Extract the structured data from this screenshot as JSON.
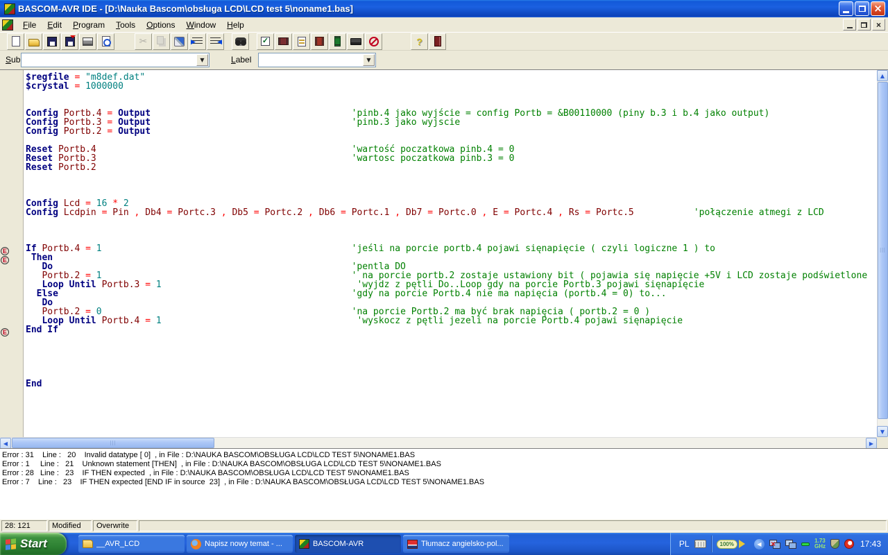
{
  "window": {
    "title": "BASCOM-AVR IDE - [D:\\Nauka Bascom\\obsługa LCD\\LCD test 5\\noname1.bas]"
  },
  "menu": {
    "items": [
      "File",
      "Edit",
      "Program",
      "Tools",
      "Options",
      "Window",
      "Help"
    ]
  },
  "toolbar": {
    "buttons": [
      {
        "name": "new-file-button",
        "icon": "new-file-icon",
        "cls": "i-new"
      },
      {
        "name": "open-file-button",
        "icon": "open-folder-icon",
        "cls": "i-open"
      },
      {
        "name": "save-button",
        "icon": "save-floppy-icon",
        "cls": "i-save"
      },
      {
        "name": "save-all-button",
        "icon": "save-all-icon",
        "cls": "i-saveas"
      },
      {
        "name": "print-button",
        "icon": "printer-icon",
        "cls": "i-print"
      },
      {
        "name": "print-preview-button",
        "icon": "print-preview-icon",
        "cls": "i-preview"
      },
      {
        "name": "cut-button",
        "icon": "scissors-icon",
        "cls": "i-cut",
        "glyph": "✂",
        "disabled": true,
        "gap": true
      },
      {
        "name": "copy-button",
        "icon": "copy-icon",
        "cls": "i-copy",
        "disabled": true
      },
      {
        "name": "format-brush-button",
        "icon": "brush-icon",
        "cls": "i-brush"
      },
      {
        "name": "indent-button",
        "icon": "indent-icon",
        "cls": "i-ind"
      },
      {
        "name": "unindent-button",
        "icon": "unindent-icon",
        "cls": "i-unind"
      },
      {
        "name": "find-button",
        "icon": "binoculars-icon",
        "cls": "i-find",
        "gap2": true
      },
      {
        "name": "syntax-check-button",
        "icon": "check-icon",
        "cls": "i-check",
        "glyph": "✓",
        "gap2": true
      },
      {
        "name": "compile-button",
        "icon": "compile-chip-icon",
        "cls": "i-chip1"
      },
      {
        "name": "show-result-button",
        "icon": "show-result-icon",
        "cls": "i-result"
      },
      {
        "name": "program-chip-button",
        "icon": "program-chip-icon",
        "cls": "i-chip2"
      },
      {
        "name": "simulator-button",
        "icon": "simulator-icon",
        "cls": "i-sim"
      },
      {
        "name": "terminal-button",
        "icon": "terminal-icon",
        "cls": "i-term"
      },
      {
        "name": "stop-button",
        "icon": "stop-icon",
        "cls": "i-stop"
      },
      {
        "name": "help-button",
        "icon": "help-icon",
        "cls": "i-help",
        "glyph": "?",
        "gap3": true
      },
      {
        "name": "exit-button",
        "icon": "exit-door-icon",
        "cls": "i-exit"
      }
    ]
  },
  "subbar": {
    "sub_label": "Sub",
    "label_label": "Label",
    "sub_value": "",
    "label_value": ""
  },
  "editor": {
    "error_marker_glyph": "E",
    "lines": [
      {
        "tk": [
          {
            "s": "k",
            "t": "$regfile"
          },
          {
            "s": "o",
            "t": " = "
          },
          {
            "s": "v",
            "t": "\"m8def.dat\""
          }
        ]
      },
      {
        "tk": [
          {
            "s": "k",
            "t": "$crystal"
          },
          {
            "s": "o",
            "t": " = "
          },
          {
            "s": "v",
            "t": "1000000"
          }
        ]
      },
      {
        "tk": []
      },
      {
        "tk": []
      },
      {
        "tk": [
          {
            "s": "k",
            "t": "Config"
          },
          {
            "s": "i",
            "t": " Portb.4"
          },
          {
            "s": "o",
            "t": " = "
          },
          {
            "s": "k",
            "t": "Output"
          },
          {
            "p": 37
          },
          {
            "s": "c",
            "t": "'pinb.4 jako wyjście = config Portb = &B00110000 (piny b.3 i b.4 jako output)"
          }
        ]
      },
      {
        "tk": [
          {
            "s": "k",
            "t": "Config"
          },
          {
            "s": "i",
            "t": " Portb.3"
          },
          {
            "s": "o",
            "t": " = "
          },
          {
            "s": "k",
            "t": "Output"
          },
          {
            "p": 37
          },
          {
            "s": "c",
            "t": "'pinb.3 jako wyjscie"
          }
        ]
      },
      {
        "tk": [
          {
            "s": "k",
            "t": "Config"
          },
          {
            "s": "i",
            "t": " Portb.2"
          },
          {
            "s": "o",
            "t": " = "
          },
          {
            "s": "k",
            "t": "Output"
          }
        ]
      },
      {
        "tk": []
      },
      {
        "tk": [
          {
            "s": "k",
            "t": "Reset"
          },
          {
            "s": "i",
            "t": " Portb.4"
          },
          {
            "p": 47
          },
          {
            "s": "c",
            "t": "'wartość poczatkowa pinb.4 = 0"
          }
        ]
      },
      {
        "tk": [
          {
            "s": "k",
            "t": "Reset"
          },
          {
            "s": "i",
            "t": " Portb.3"
          },
          {
            "p": 47
          },
          {
            "s": "c",
            "t": "'wartosc poczatkowa pinb.3 = 0"
          }
        ]
      },
      {
        "tk": [
          {
            "s": "k",
            "t": "Reset"
          },
          {
            "s": "i",
            "t": " Portb.2"
          }
        ]
      },
      {
        "tk": []
      },
      {
        "tk": []
      },
      {
        "tk": []
      },
      {
        "tk": [
          {
            "s": "k",
            "t": "Config"
          },
          {
            "s": "i",
            "t": " Lcd"
          },
          {
            "s": "o",
            "t": " = "
          },
          {
            "s": "v",
            "t": "16"
          },
          {
            "s": "o",
            "t": " * "
          },
          {
            "s": "v",
            "t": "2"
          }
        ]
      },
      {
        "tk": [
          {
            "s": "k",
            "t": "Config"
          },
          {
            "s": "i",
            "t": " Lcdpin"
          },
          {
            "s": "o",
            "t": " = "
          },
          {
            "s": "i",
            "t": "Pin"
          },
          {
            "s": "o",
            "t": " , "
          },
          {
            "s": "i",
            "t": "Db4"
          },
          {
            "s": "o",
            "t": " = "
          },
          {
            "s": "i",
            "t": "Portc.3"
          },
          {
            "s": "o",
            "t": " , "
          },
          {
            "s": "i",
            "t": "Db5"
          },
          {
            "s": "o",
            "t": " = "
          },
          {
            "s": "i",
            "t": "Portc.2"
          },
          {
            "s": "o",
            "t": " , "
          },
          {
            "s": "i",
            "t": "Db6"
          },
          {
            "s": "o",
            "t": " = "
          },
          {
            "s": "i",
            "t": "Portc.1"
          },
          {
            "s": "o",
            "t": " , "
          },
          {
            "s": "i",
            "t": "Db7"
          },
          {
            "s": "o",
            "t": " = "
          },
          {
            "s": "i",
            "t": "Portc.0"
          },
          {
            "s": "o",
            "t": " , "
          },
          {
            "s": "i",
            "t": "E"
          },
          {
            "s": "o",
            "t": " = "
          },
          {
            "s": "i",
            "t": "Portc.4"
          },
          {
            "s": "o",
            "t": " , "
          },
          {
            "s": "i",
            "t": "Rs"
          },
          {
            "s": "o",
            "t": " = "
          },
          {
            "s": "i",
            "t": "Portc.5"
          },
          {
            "p": 11
          },
          {
            "s": "c",
            "t": "'połączenie atmegi z LCD"
          }
        ]
      },
      {
        "tk": []
      },
      {
        "tk": []
      },
      {
        "tk": []
      },
      {
        "e": true,
        "tk": [
          {
            "s": "k",
            "t": "If"
          },
          {
            "s": "i",
            "t": " Portb.4"
          },
          {
            "s": "o",
            "t": " = "
          },
          {
            "s": "v",
            "t": "1"
          },
          {
            "p": 46
          },
          {
            "s": "c",
            "t": "'jeśli na porcie portb.4 pojawi sięnapięcie ( czyli logiczne 1 ) to"
          }
        ]
      },
      {
        "e": true,
        "tk": [
          {
            "s": "k",
            "t": " Then"
          }
        ]
      },
      {
        "tk": [
          {
            "s": "k",
            "t": "   Do"
          },
          {
            "p": 55
          },
          {
            "s": "c",
            "t": "'pentla DO"
          }
        ]
      },
      {
        "tk": [
          {
            "s": "i",
            "t": "   Portb.2"
          },
          {
            "s": "o",
            "t": " = "
          },
          {
            "s": "v",
            "t": "1"
          },
          {
            "p": 46
          },
          {
            "s": "c",
            "t": "' na porcie portb.2 zostaje ustawiony bit ( pojawia się napięcie +5V i LCD zostaje podświetlone"
          }
        ]
      },
      {
        "tk": [
          {
            "s": "k",
            "t": "   Loop Until"
          },
          {
            "s": "i",
            "t": " Portb.3"
          },
          {
            "s": "o",
            "t": " = "
          },
          {
            "s": "v",
            "t": "1"
          },
          {
            "p": 35
          },
          {
            "s": "c",
            "t": " 'wyjdz z pętli Do..Loop gdy na porcie Portb.3 pojawi sięnapięcie"
          }
        ]
      },
      {
        "tk": [
          {
            "s": "k",
            "t": "  Else"
          },
          {
            "p": 54
          },
          {
            "s": "c",
            "t": "'gdy na porcie Portb.4 nie ma napięcia (portb.4 = 0) to..."
          }
        ]
      },
      {
        "tk": [
          {
            "s": "k",
            "t": "   Do"
          }
        ]
      },
      {
        "tk": [
          {
            "s": "i",
            "t": "   Portb.2"
          },
          {
            "s": "o",
            "t": " = "
          },
          {
            "s": "v",
            "t": "0"
          },
          {
            "p": 46
          },
          {
            "s": "c",
            "t": "'na porcie Portb.2 ma być brak napięcia ( portb.2 = 0 )"
          }
        ]
      },
      {
        "tk": [
          {
            "s": "k",
            "t": "   Loop Until"
          },
          {
            "s": "i",
            "t": " Portb.4"
          },
          {
            "s": "o",
            "t": " = "
          },
          {
            "s": "v",
            "t": "1"
          },
          {
            "p": 35
          },
          {
            "s": "c",
            "t": " 'wyskocz z pętli jezeli na porcie Portb.4 pojawi sięnapięcie"
          }
        ]
      },
      {
        "e": true,
        "tk": [
          {
            "s": "k",
            "t": "End If"
          }
        ]
      },
      {
        "tk": []
      },
      {
        "tk": []
      },
      {
        "tk": []
      },
      {
        "tk": []
      },
      {
        "tk": []
      },
      {
        "tk": [
          {
            "s": "k",
            "t": "End"
          }
        ]
      }
    ]
  },
  "errors": [
    "Error : 31    Line :   20    Invalid datatype [ 0]  , in File : D:\\NAUKA BASCOM\\OBSŁUGA LCD\\LCD TEST 5\\NONAME1.BAS",
    "Error : 1     Line :   21    Unknown statement [THEN]  , in File : D:\\NAUKA BASCOM\\OBSŁUGA LCD\\LCD TEST 5\\NONAME1.BAS",
    "Error : 28   Line :   23    IF THEN expected  , in File : D:\\NAUKA BASCOM\\OBSŁUGA LCD\\LCD TEST 5\\NONAME1.BAS",
    "Error : 7    Line :   23    IF THEN expected [END IF in source  23]  , in File : D:\\NAUKA BASCOM\\OBSŁUGA LCD\\LCD TEST 5\\NONAME1.BAS"
  ],
  "statusbar": {
    "position": "28: 121",
    "modified": "Modified",
    "mode": "Overwrite"
  },
  "taskbar": {
    "start_label": "Start",
    "tasks": [
      {
        "id": "avr-lcd-folder",
        "icon": "folder-icon",
        "cls": "tic-folder",
        "label": "__AVR_LCD",
        "active": false
      },
      {
        "id": "firefox",
        "icon": "firefox-icon",
        "cls": "tic-firefox",
        "label": "Napisz nowy temat - ...",
        "active": false
      },
      {
        "id": "bascom-avr",
        "icon": "bascom-icon",
        "cls": "tic-bascom",
        "label": "BASCOM-AVR",
        "active": true
      },
      {
        "id": "translator",
        "icon": "translator-icon",
        "cls": "tic-translator",
        "label": "Tłumacz angielsko-pol...",
        "active": false
      }
    ],
    "tray": {
      "language": "PL",
      "volume": "100%",
      "cpu_value": "1.73",
      "cpu_unit": "GHz",
      "clock": "17:43"
    }
  }
}
